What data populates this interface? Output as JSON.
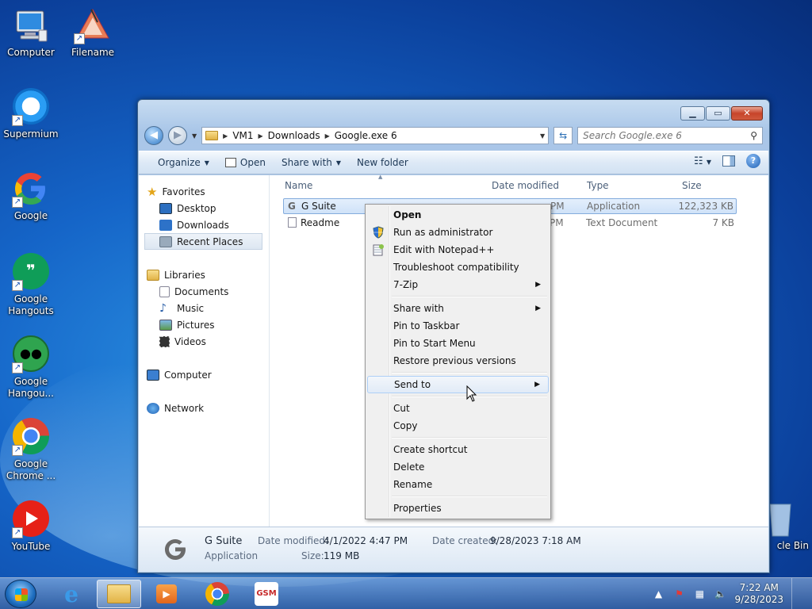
{
  "desktop": {
    "icons": [
      {
        "label": "Computer"
      },
      {
        "label": "Filename"
      },
      {
        "label": "Supermium"
      },
      {
        "label": "Google"
      },
      {
        "label": "Google Hangouts"
      },
      {
        "label": "Google Hangou..."
      },
      {
        "label": "Google Chrome ..."
      },
      {
        "label": "YouTube"
      },
      {
        "label": "cle Bin"
      }
    ]
  },
  "window": {
    "breadcrumb": [
      "VM1",
      "Downloads",
      "Google.exe 6"
    ],
    "search_placeholder": "Search Google.exe 6",
    "toolbar": {
      "organize": "Organize",
      "open": "Open",
      "share_with": "Share with",
      "new_folder": "New folder"
    },
    "navpane": {
      "favorites": "Favorites",
      "desktop": "Desktop",
      "downloads": "Downloads",
      "readme": "Readme",
      "recent": "Recent Places",
      "libraries": "Libraries",
      "documents": "Documents",
      "music": "Music",
      "pictures": "Pictures",
      "videos": "Videos",
      "computer": "Computer",
      "network": "Network"
    },
    "columns": {
      "name": "Name",
      "date": "Date modified",
      "type": "Type",
      "size": "Size"
    },
    "files": [
      {
        "name": "G Suite",
        "date_tail": "PM",
        "type": "Application",
        "size": "122,323 KB"
      },
      {
        "name": "Readme",
        "date_tail": "PM",
        "type": "Text Document",
        "size": "7 KB"
      }
    ],
    "details": {
      "name": "G Suite",
      "kind": "Application",
      "modified_label": "Date modified:",
      "modified_value": "4/1/2022 4:47 PM",
      "size_label": "Size:",
      "size_value": "119 MB",
      "created_label": "Date created:",
      "created_value": "9/28/2023 7:18 AM"
    }
  },
  "context_menu": {
    "open": "Open",
    "run_admin": "Run as administrator",
    "notepad": "Edit with Notepad++",
    "troubleshoot": "Troubleshoot compatibility",
    "zip": "7-Zip",
    "share_with": "Share with",
    "pin_taskbar": "Pin to Taskbar",
    "pin_start": "Pin to Start Menu",
    "restore": "Restore previous versions",
    "send_to": "Send to",
    "cut": "Cut",
    "copy": "Copy",
    "create_shortcut": "Create shortcut",
    "delete": "Delete",
    "rename": "Rename",
    "properties": "Properties"
  },
  "taskbar": {
    "time": "7:22 AM",
    "date": "9/28/2023"
  },
  "colors": {
    "accent": "#1d6dbf",
    "selection": "#cfe2f8",
    "menu_bg": "#f0f0f0"
  }
}
